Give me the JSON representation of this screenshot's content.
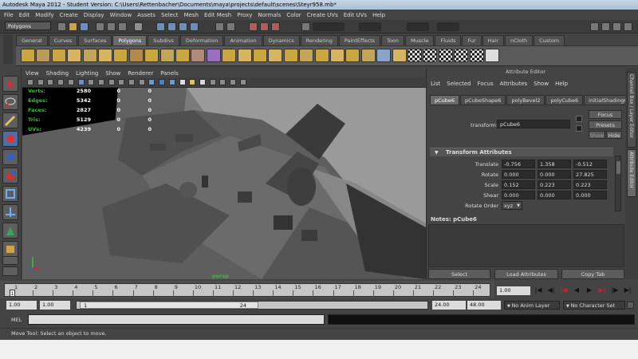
{
  "window": {
    "title": "Autodesk Maya 2012 - Student Version: C:\\Users\\Rettenbacher\\Documents\\maya\\projects\\default\\scenes\\Steyr958.mb*"
  },
  "menubar": [
    "File",
    "Edit",
    "Modify",
    "Create",
    "Display",
    "Window",
    "Assets",
    "Select",
    "Mesh",
    "Edit Mesh",
    "Proxy",
    "Normals",
    "Color",
    "Create UVs",
    "Edit UVs",
    "Help"
  ],
  "status_line": {
    "mode": "Polygons"
  },
  "shelf": {
    "tabs": [
      "General",
      "Curves",
      "Surfaces",
      "Polygons",
      "Subdivs",
      "Deformation",
      "Animation",
      "Dynamics",
      "Rendering",
      "PaintEffects",
      "Toon",
      "Muscle",
      "Fluids",
      "Fur",
      "Hair",
      "nCloth",
      "Custom"
    ],
    "active_tab": "Polygons"
  },
  "viewport": {
    "menu": [
      "View",
      "Shading",
      "Lighting",
      "Show",
      "Renderer",
      "Panels"
    ],
    "hud": [
      {
        "label": "Verts:",
        "v1": "2580",
        "v2": "0",
        "v3": "0"
      },
      {
        "label": "Edges:",
        "v1": "5342",
        "v2": "0",
        "v3": "0"
      },
      {
        "label": "Faces:",
        "v1": "2827",
        "v2": "0",
        "v3": "0"
      },
      {
        "label": "Tris:",
        "v1": "5129",
        "v2": "0",
        "v3": "0"
      },
      {
        "label": "UVs:",
        "v1": "4239",
        "v2": "0",
        "v3": "0"
      }
    ],
    "camera_label": "persp"
  },
  "attribute_editor": {
    "title": "Attribute Editor",
    "menu": [
      "List",
      "Selected",
      "Focus",
      "Attributes",
      "Show",
      "Help"
    ],
    "tabs": [
      "pCube6",
      "pCubeShape6",
      "polyBevel2",
      "polyCube6",
      "initialShadingGr"
    ],
    "active_tab": "pCube6",
    "transform_label": "transform:",
    "transform_value": "pCube6",
    "buttons": {
      "focus": "Focus",
      "presets": "Presets",
      "show": "Show",
      "hide": "Hide"
    },
    "section_title": "Transform Attributes",
    "rows": [
      {
        "label": "Translate",
        "values": [
          "-0.756",
          "1.358",
          "-0.512"
        ]
      },
      {
        "label": "Rotate",
        "values": [
          "0.000",
          "0.000",
          "27.825"
        ]
      },
      {
        "label": "Scale",
        "values": [
          "0.152",
          "0.223",
          "0.223"
        ]
      },
      {
        "label": "Shear",
        "values": [
          "0.000",
          "0.000",
          "0.000"
        ]
      }
    ],
    "rotate_order_label": "Rotate Order",
    "rotate_order_value": "xyz",
    "notes_label": "Notes:  pCube6",
    "bottom_buttons": {
      "select": "Select",
      "load": "Load Attributes",
      "copy": "Copy Tab"
    }
  },
  "side_tabs": [
    "Channel Box / Layer Editor",
    "Attribute Editor"
  ],
  "time_slider": {
    "ticks": [
      "1",
      "2",
      "3",
      "4",
      "5",
      "6",
      "7",
      "8",
      "9",
      "10",
      "11",
      "12",
      "13",
      "14",
      "15",
      "16",
      "17",
      "18",
      "19",
      "20",
      "21",
      "22",
      "23",
      "24"
    ],
    "current_frame_marker": "1",
    "current_frame": "1.00"
  },
  "range_slider": {
    "start": "1.00",
    "current_start": "1.00",
    "handle_start": "1",
    "handle_end": "24",
    "end_playback": "24.00",
    "end_animation": "48.00",
    "anim_layer": "No Anim Layer",
    "character_set": "No Character Set"
  },
  "command_line": {
    "label": "MEL"
  },
  "help_line": {
    "text": "Move Tool: Select an object to move."
  }
}
